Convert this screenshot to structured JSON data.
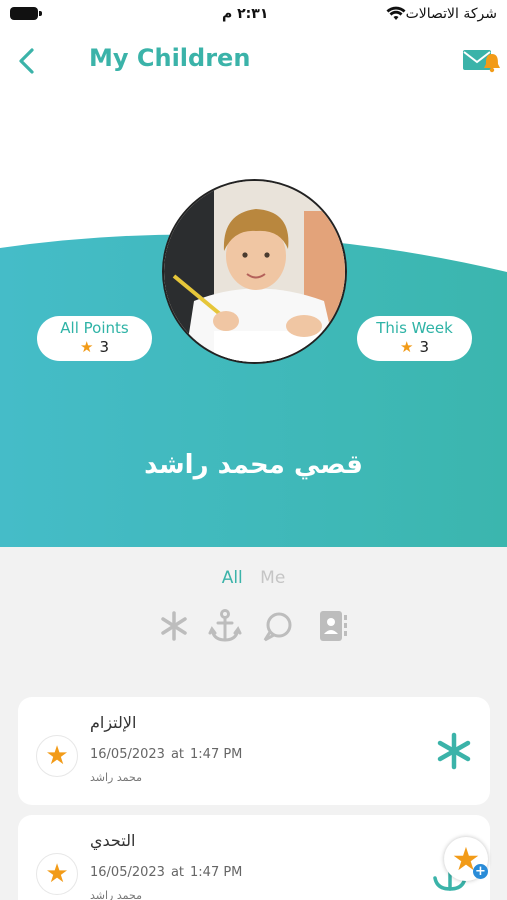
{
  "status_bar": {
    "time": "٢:٣١ م",
    "carrier": "شركة الاتصالات"
  },
  "header": {
    "title": "My Children"
  },
  "profile": {
    "name": "قصي محمد راشد",
    "all_points": {
      "label": "All Points",
      "value": "3"
    },
    "this_week": {
      "label": "This Week",
      "value": "3"
    }
  },
  "filter": {
    "tabs": [
      "All",
      "Me"
    ],
    "active_tab": "All",
    "icons": [
      "asterisk-icon",
      "anchor-icon",
      "chat-bubble-icon",
      "contacts-book-icon"
    ]
  },
  "activities": [
    {
      "title": "الإلتزام",
      "date": "16/05/2023",
      "at": "at",
      "time": "1:47 PM",
      "author": "محمد راشد",
      "icon": "asterisk-icon"
    },
    {
      "title": "التحدي",
      "date": "16/05/2023",
      "at": "at",
      "time": "1:47 PM",
      "author": "محمد راشد",
      "icon": "anchor-icon"
    }
  ],
  "colors": {
    "accent": "#3bb3a9",
    "gradient_start": "#45bcc8",
    "gradient_end": "#3bb6ae",
    "star": "#f29b18",
    "fab_plus": "#2a8cd8"
  }
}
